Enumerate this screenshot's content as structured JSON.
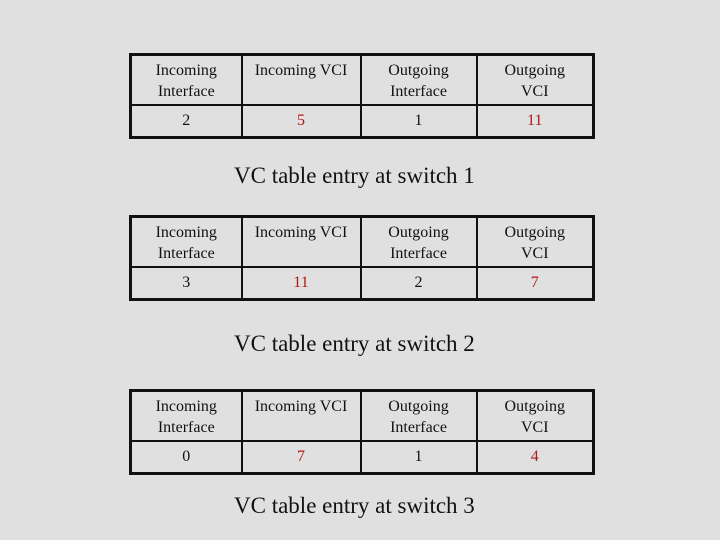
{
  "headers": [
    "Incoming Interface",
    "Incoming VCI",
    "Outgoing Interface",
    "Outgoing VCI"
  ],
  "header_lines": {
    "col1": [
      "Incoming",
      "Interface"
    ],
    "col2": [
      "Incoming VCI"
    ],
    "col3": [
      "Outgoing",
      "Interface"
    ],
    "col4": [
      "Outgoing",
      "VCI"
    ]
  },
  "highlight_color": "#b01818",
  "tables": [
    {
      "caption": "VC table entry at switch 1",
      "row": {
        "incoming_interface": "2",
        "incoming_vci": "5",
        "outgoing_interface": "1",
        "outgoing_vci": "11"
      }
    },
    {
      "caption": "VC table entry at switch 2",
      "row": {
        "incoming_interface": "3",
        "incoming_vci": "11",
        "outgoing_interface": "2",
        "outgoing_vci": "7"
      }
    },
    {
      "caption": "VC table entry at switch 3",
      "row": {
        "incoming_interface": "0",
        "incoming_vci": "7",
        "outgoing_interface": "1",
        "outgoing_vci": "4"
      }
    }
  ]
}
